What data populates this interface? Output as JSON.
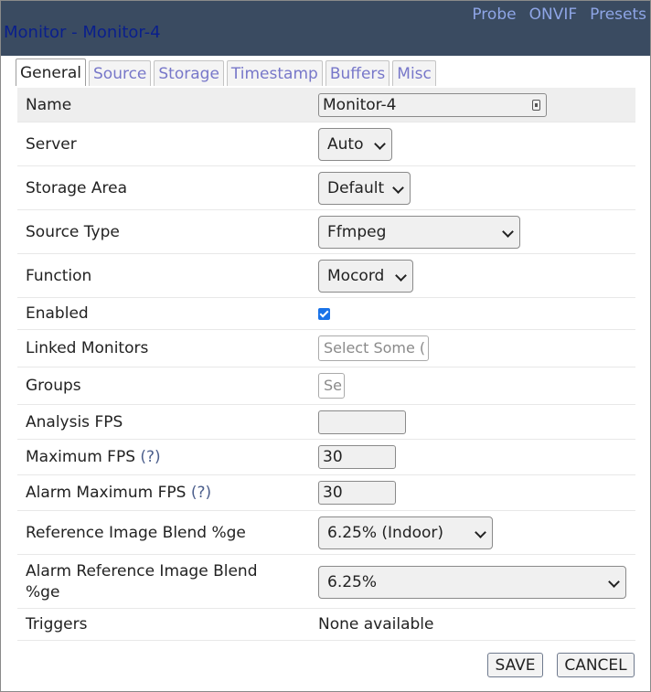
{
  "window": {
    "title": "Monitor - Monitor-4",
    "links": [
      "Probe",
      "ONVIF",
      "Presets"
    ]
  },
  "tabs": [
    "General",
    "Source",
    "Storage",
    "Timestamp",
    "Buffers",
    "Misc"
  ],
  "active_tab": "General",
  "fields": {
    "name": {
      "label": "Name",
      "value": "Monitor-4"
    },
    "server": {
      "label": "Server",
      "value": "Auto"
    },
    "storage_area": {
      "label": "Storage Area",
      "value": "Default"
    },
    "source_type": {
      "label": "Source Type",
      "value": "Ffmpeg"
    },
    "function": {
      "label": "Function",
      "value": "Mocord"
    },
    "enabled": {
      "label": "Enabled",
      "checked": true
    },
    "linked_monitors": {
      "label": "Linked Monitors",
      "placeholder": "Select Some ("
    },
    "groups": {
      "label": "Groups",
      "placeholder": "Se"
    },
    "analysis_fps": {
      "label": "Analysis FPS",
      "value": ""
    },
    "maximum_fps": {
      "label": "Maximum FPS",
      "help": "(?)",
      "value": "30"
    },
    "alarm_maximum_fps": {
      "label": "Alarm Maximum FPS",
      "help": "(?)",
      "value": "30"
    },
    "ref_blend": {
      "label": "Reference Image Blend %ge",
      "value": "6.25% (Indoor)"
    },
    "alarm_ref_blend": {
      "label_line1": "Alarm Reference Image Blend",
      "label_line2": "%ge",
      "value": "6.25%"
    },
    "triggers": {
      "label": "Triggers",
      "value": "None available"
    }
  },
  "buttons": {
    "save": "SAVE",
    "cancel": "CANCEL"
  },
  "colors": {
    "titlebar": "#3a4b61",
    "title_text": "#0a1f8c",
    "header_link": "#8ea5e6",
    "tab_link": "#7777c9",
    "checkbox": "#1a73e8"
  }
}
